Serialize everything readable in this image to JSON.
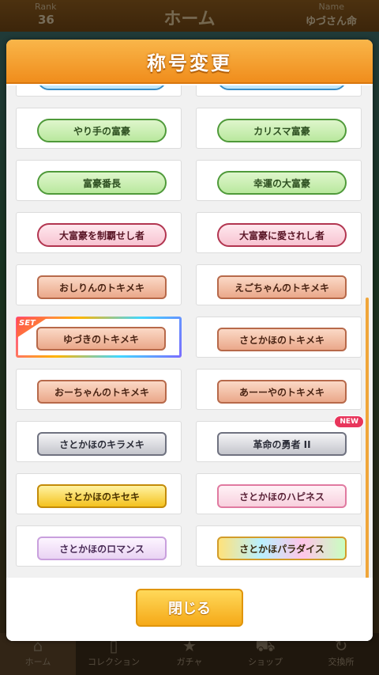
{
  "header": {
    "rank_label": "Rank",
    "rank_value": "36",
    "title": "ホーム",
    "name_label": "Name",
    "name_value": "ゆづさん命"
  },
  "modal": {
    "title": "称号変更",
    "close_label": "閉じる",
    "set_badge": "SET",
    "new_badge": "NEW",
    "titles": [
      {
        "label": "やり手の富豪",
        "style": "green"
      },
      {
        "label": "カリスマ富豪",
        "style": "green"
      },
      {
        "label": "富豪番長",
        "style": "green"
      },
      {
        "label": "幸運の大富豪",
        "style": "green"
      },
      {
        "label": "大富豪を制覇せし者",
        "style": "pink"
      },
      {
        "label": "大富豪に愛されし者",
        "style": "pink"
      },
      {
        "label": "おしりんのトキメキ",
        "style": "copper"
      },
      {
        "label": "えごちゃんのトキメキ",
        "style": "copper"
      },
      {
        "label": "ゆづきのトキメキ",
        "style": "copper",
        "selected": true
      },
      {
        "label": "さとかほのトキメキ",
        "style": "copper"
      },
      {
        "label": "おーちゃんのトキメキ",
        "style": "copper"
      },
      {
        "label": "あーーやのトキメキ",
        "style": "copper"
      },
      {
        "label": "さとかほのキラメキ",
        "style": "silver"
      },
      {
        "label": "革命の勇者 II",
        "style": "silver",
        "new": true
      },
      {
        "label": "さとかほのキセキ",
        "style": "gold"
      },
      {
        "label": "さとかほのハピネス",
        "style": "pinkfancy"
      },
      {
        "label": "さとかほのロマンス",
        "style": "lilac"
      },
      {
        "label": "さとかほパラダイス",
        "style": "rainbow"
      }
    ]
  },
  "nav": {
    "items": [
      {
        "label": "ホーム",
        "icon": "home-icon"
      },
      {
        "label": "コレクション",
        "icon": "collection-icon"
      },
      {
        "label": "ガチャ",
        "icon": "gacha-icon"
      },
      {
        "label": "ショップ",
        "icon": "cart-icon"
      },
      {
        "label": "交換所",
        "icon": "exchange-icon"
      }
    ]
  },
  "colors": {
    "header_orange": "#f08d1c",
    "close_button": "#f5a918",
    "scrollbar": "#f0a63a"
  }
}
